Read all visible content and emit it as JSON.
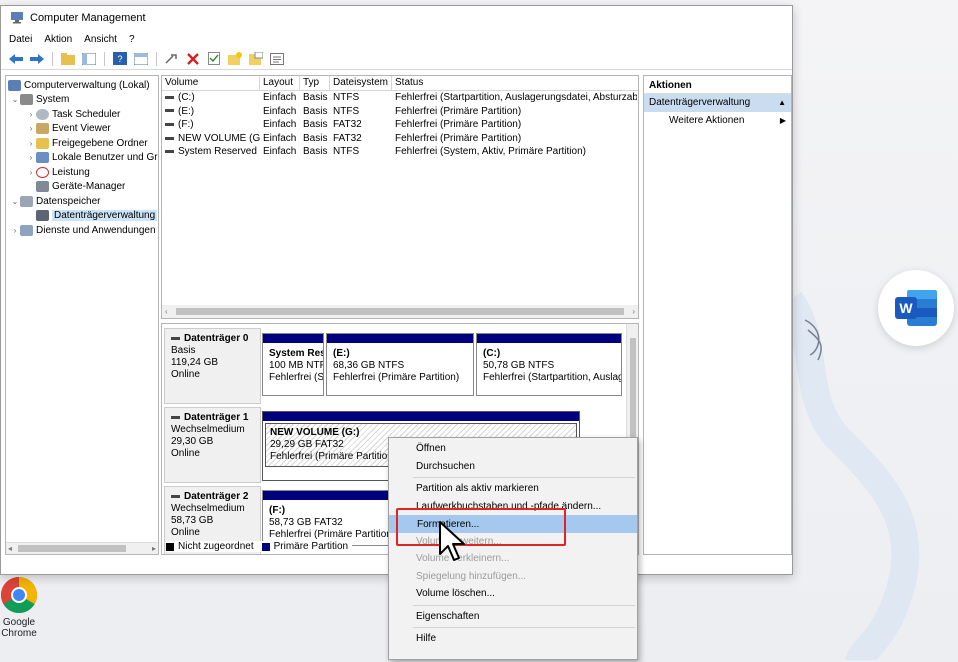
{
  "window": {
    "title": "Computer Management",
    "menu": [
      "Datei",
      "Aktion",
      "Ansicht",
      "?"
    ]
  },
  "tree": {
    "items": [
      {
        "label": "Computerverwaltung (Lokal)",
        "indent": 0,
        "exp": ""
      },
      {
        "label": "System",
        "indent": 1,
        "exp": "v"
      },
      {
        "label": "Task Scheduler",
        "indent": 2,
        "exp": ">"
      },
      {
        "label": "Event Viewer",
        "indent": 2,
        "exp": ">"
      },
      {
        "label": "Freigegebene Ordner",
        "indent": 2,
        "exp": ">"
      },
      {
        "label": "Lokale Benutzer und Gr",
        "indent": 2,
        "exp": ">"
      },
      {
        "label": "Leistung",
        "indent": 2,
        "exp": ">"
      },
      {
        "label": "Geräte-Manager",
        "indent": 2,
        "exp": ""
      },
      {
        "label": "Datenspeicher",
        "indent": 1,
        "exp": "v"
      },
      {
        "label": "Datenträgerverwaltung",
        "indent": 2,
        "exp": "",
        "selected": true
      },
      {
        "label": "Dienste und Anwendungen",
        "indent": 1,
        "exp": ">"
      }
    ]
  },
  "volumes": {
    "headers": [
      "Volume",
      "Layout",
      "Typ",
      "Dateisystem",
      "Status"
    ],
    "rows": [
      [
        "(C:)",
        "Einfach",
        "Basis",
        "NTFS",
        "Fehlerfrei (Startpartition, Auslagerungsdatei, Absturzabbi"
      ],
      [
        "(E:)",
        "Einfach",
        "Basis",
        "NTFS",
        "Fehlerfrei (Primäre Partition)"
      ],
      [
        "(F:)",
        "Einfach",
        "Basis",
        "FAT32",
        "Fehlerfrei (Primäre Partition)"
      ],
      [
        "NEW VOLUME (G:)",
        "Einfach",
        "Basis",
        "FAT32",
        "Fehlerfrei (Primäre Partition)"
      ],
      [
        "System Reserved",
        "Einfach",
        "Basis",
        "NTFS",
        "Fehlerfrei (System, Aktiv, Primäre Partition)"
      ]
    ]
  },
  "disks": [
    {
      "name": "Datenträger 0",
      "type": "Basis",
      "size": "119,24 GB",
      "state": "Online"
    },
    {
      "name": "Datenträger 1",
      "type": "Wechselmedium",
      "size": "29,30 GB",
      "state": "Online"
    },
    {
      "name": "Datenträger 2",
      "type": "Wechselmedium",
      "size": "58,73 GB",
      "state": "Online"
    }
  ],
  "partitions": {
    "d0p1": {
      "title": "System Res",
      "size": "100 MB NTF",
      "status": "Fehlerfrei (S"
    },
    "d0p2": {
      "title": "(E:)",
      "size": "68,36 GB NTFS",
      "status": "Fehlerfrei (Primäre Partition)"
    },
    "d0p3": {
      "title": "(C:)",
      "size": "50,78 GB NTFS",
      "status": "Fehlerfrei (Startpartition, Auslag"
    },
    "d1p1": {
      "title": "NEW VOLUME  (G:)",
      "size": "29,29 GB FAT32",
      "status": "Fehlerfrei (Primäre Partition)"
    },
    "d2p1": {
      "title": "(F:)",
      "size": "58,73 GB FAT32",
      "status": "Fehlerfrei (Primäre Partition)"
    }
  },
  "legend": {
    "unallocated": "Nicht zugeordnet",
    "primary": "Primäre Partition"
  },
  "actions": {
    "header": "Aktionen",
    "section": "Datenträgerverwaltung",
    "more": "Weitere Aktionen"
  },
  "context_menu": {
    "open": "Öffnen",
    "explore": "Durchsuchen",
    "mark_active": "Partition als aktiv markieren",
    "change_letter": "Laufwerkbuchstaben und -pfade ändern...",
    "format": "Formatieren...",
    "extend": "Volume erweitern...",
    "shrink": "Volume verkleinern...",
    "mirror": "Spiegelung hinzufügen...",
    "delete": "Volume löschen...",
    "properties": "Eigenschaften",
    "help": "Hilfe"
  },
  "desktop": {
    "chrome_label": "Google Chrome"
  },
  "colors": {
    "primary_partition": "#00007f",
    "highlight": "#a5c9ee",
    "annotation": "#e12424"
  }
}
